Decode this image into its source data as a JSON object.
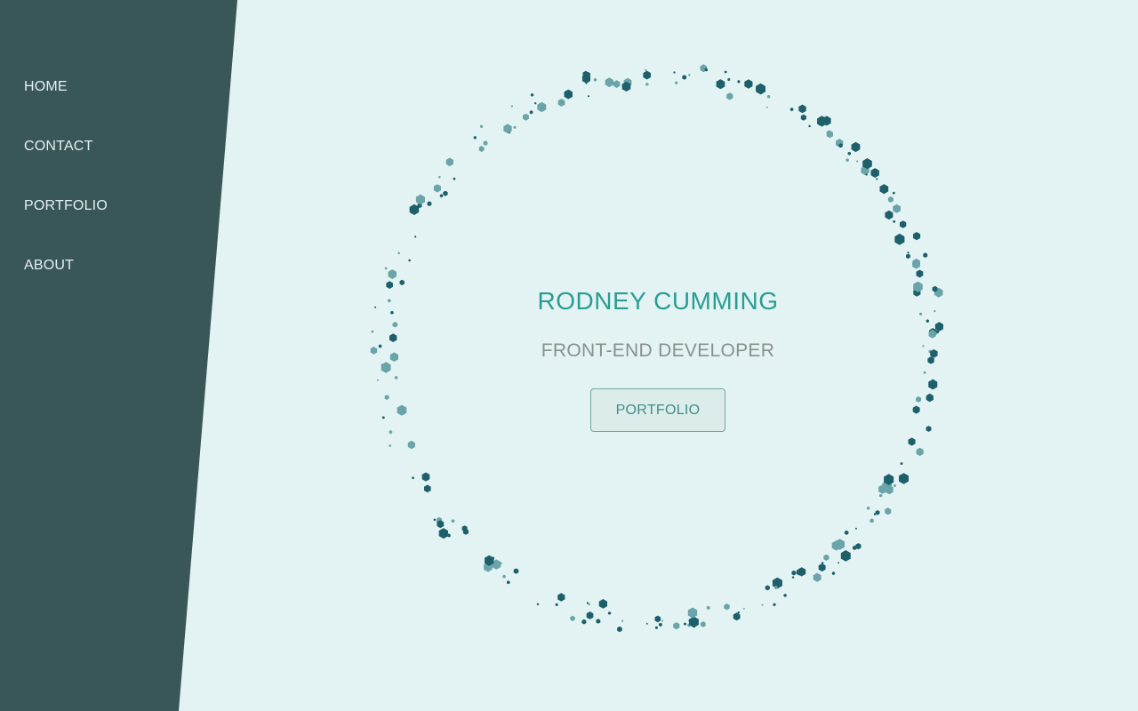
{
  "nav": {
    "items": [
      {
        "label": "HOME"
      },
      {
        "label": "CONTACT"
      },
      {
        "label": "PORTFOLIO"
      },
      {
        "label": "ABOUT"
      }
    ]
  },
  "hero": {
    "title": "RODNEY CUMMING",
    "subtitle": "FRONT-END DEVELOPER",
    "button_label": "PORTFOLIO"
  },
  "colors": {
    "sidebar": "#3a5758",
    "background": "#e3f3f3",
    "accent": "#2a9d93",
    "hexagon_dark": "#1d5f6a",
    "hexagon_light": "#6aa4a8"
  }
}
